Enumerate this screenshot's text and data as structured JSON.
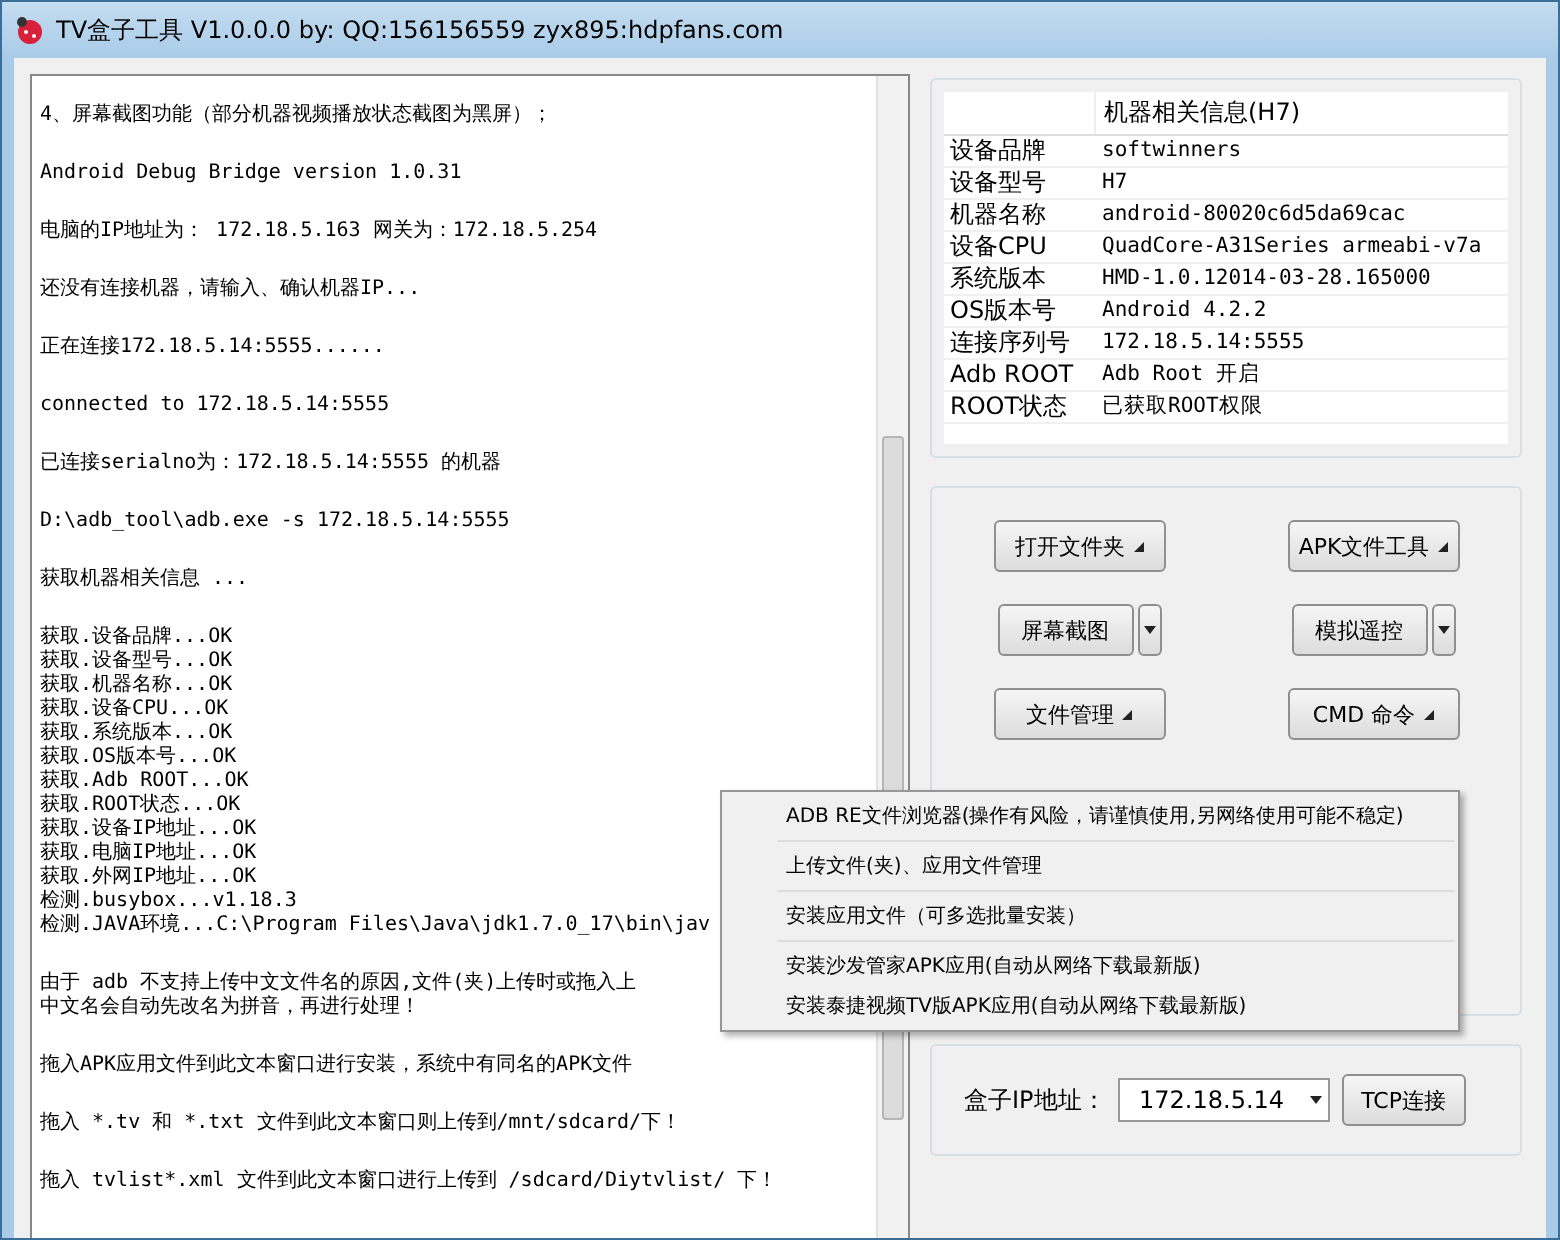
{
  "window": {
    "title": "TV盒子工具 V1.0.0.0 by: QQ:156156559  zyx895:hdpfans.com"
  },
  "log": [
    [
      "4、屏幕截图功能（部分机器视频播放状态截图为黑屏）；"
    ],
    [
      "Android Debug Bridge version 1.0.31"
    ],
    [
      "电脑的IP地址为： 172.18.5.163 网关为：172.18.5.254"
    ],
    [
      "还没有连接机器，请输入、确认机器IP..."
    ],
    [
      "正在连接172.18.5.14:5555......"
    ],
    [
      "connected to 172.18.5.14:5555"
    ],
    [
      "已连接serialno为：172.18.5.14:5555 的机器"
    ],
    [
      "D:\\adb_tool\\adb.exe -s 172.18.5.14:5555"
    ],
    [
      "获取机器相关信息 ..."
    ],
    [
      "获取.设备品牌...OK",
      "获取.设备型号...OK",
      "获取.机器名称...OK",
      "获取.设备CPU...OK",
      "获取.系统版本...OK",
      "获取.OS版本号...OK",
      "获取.Adb ROOT...OK",
      "获取.ROOT状态...OK",
      "获取.设备IP地址...OK",
      "获取.电脑IP地址...OK",
      "获取.外网IP地址...OK",
      "检测.busybox...v1.18.3",
      "检测.JAVA环境...C:\\Program Files\\Java\\jdk1.7.0_17\\bin\\jav"
    ],
    [
      "由于 adb 不支持上传中文文件名的原因,文件(夹)上传时或拖入上",
      "中文名会自动先改名为拼音，再进行处理！"
    ],
    [
      "拖入APK应用文件到此文本窗口进行安装，系统中有同名的APK文件"
    ],
    [
      "拖入 *.tv 和 *.txt 文件到此文本窗口则上传到/mnt/sdcard/下！"
    ],
    [
      "拖入 tvlist*.xml 文件到此文本窗口进行上传到 /sdcard/Diytvlist/ 下！"
    ]
  ],
  "info_table": {
    "header": "机器相关信息(H7)",
    "rows": [
      {
        "key": "设备品牌",
        "value": "softwinners"
      },
      {
        "key": "设备型号",
        "value": "H7"
      },
      {
        "key": "机器名称",
        "value": "android-80020c6d5da69cac"
      },
      {
        "key": "设备CPU",
        "value": "QuadCore-A31Series  armeabi-v7a"
      },
      {
        "key": "系统版本",
        "value": "HMD-1.0.12014-03-28.165000"
      },
      {
        "key": "OS版本号",
        "value": "Android  4.2.2"
      },
      {
        "key": "连接序列号",
        "value": "172.18.5.14:5555"
      },
      {
        "key": "Adb ROOT",
        "value": "Adb Root 开启"
      },
      {
        "key": "ROOT状态",
        "value": "已获取ROOT权限"
      }
    ]
  },
  "buttons": [
    {
      "label": "打开文件夹",
      "kind": "menu"
    },
    {
      "label": "APK文件工具",
      "kind": "menu"
    },
    {
      "label": "屏幕截图",
      "kind": "split"
    },
    {
      "label": "模拟遥控",
      "kind": "split"
    },
    {
      "label": "文件管理",
      "kind": "menu"
    },
    {
      "label": "CMD 命令",
      "kind": "menu"
    }
  ],
  "menu": [
    {
      "label": "ADB RE文件浏览器(操作有风险，请谨慎使用,另网络使用可能不稳定)",
      "separator_after": true
    },
    {
      "label": "上传文件(夹)、应用文件管理",
      "separator_after": true
    },
    {
      "label": "安装应用文件（可多选批量安装）",
      "separator_after": true
    },
    {
      "label": "安装沙发管家APK应用(自动从网络下载最新版)",
      "separator_after": false
    },
    {
      "label": "安装泰捷视频TV版APK应用(自动从网络下载最新版)",
      "separator_after": false
    }
  ],
  "connection": {
    "label": "盒子IP地址：",
    "ip": "172.18.5.14",
    "button": "TCP连接"
  }
}
